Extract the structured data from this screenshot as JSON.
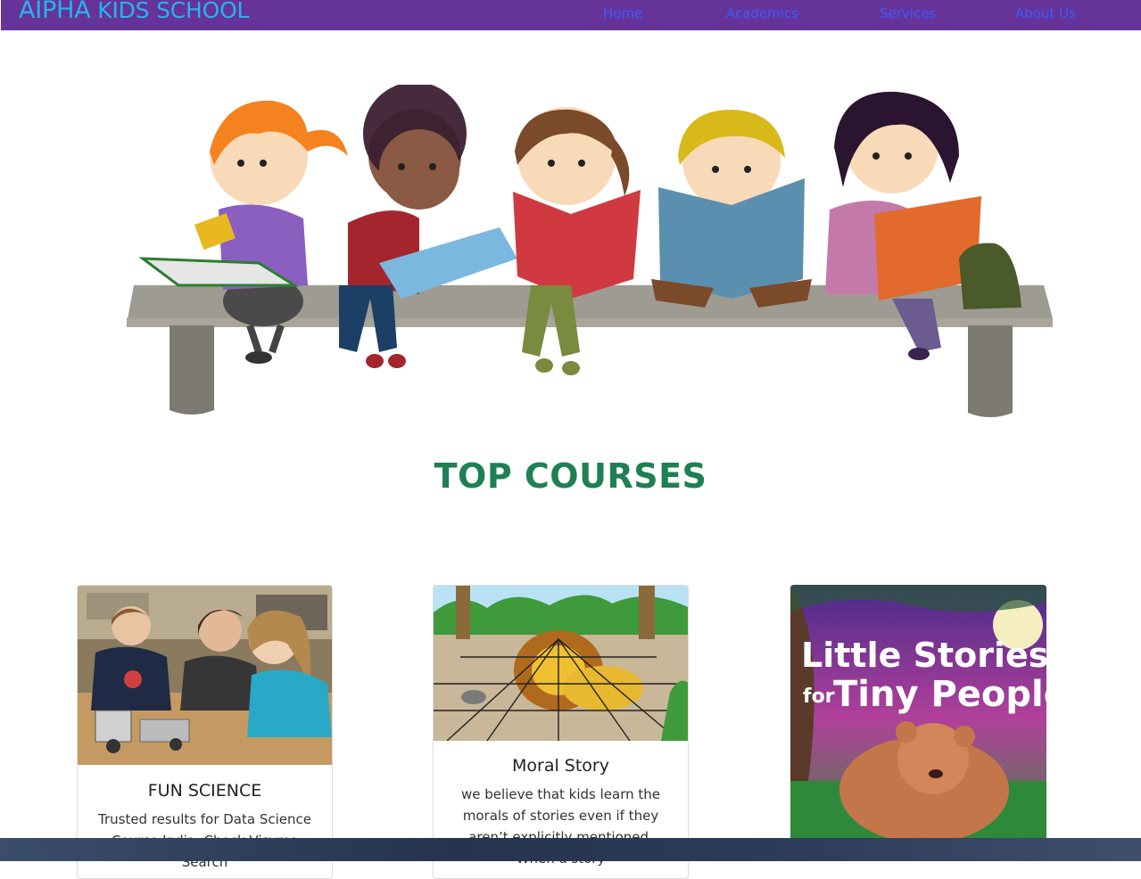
{
  "navbar": {
    "brand_big": "AIPHA",
    "brand_rest": " KIDS SCHOOL",
    "links": [
      "Home",
      "Academics",
      "Services",
      "About Us"
    ],
    "bg_color": "#663399",
    "brand_color": "#27b3f0",
    "link_color": "#3c5bff"
  },
  "section": {
    "title": "TOP COURSES",
    "title_color": "#1f7f55"
  },
  "cards": [
    {
      "title": "FUN SCIENCE",
      "text": "Trusted results for Data Science Course India. Check Visymo Search",
      "image": "kids-robotics-photo"
    },
    {
      "title": "Moral Story",
      "text": "we believe that kids learn the morals of stories even if they aren’t explicitly mentioned. When a story",
      "image": "lion-and-mouse-illustration"
    },
    {
      "image_line1": "Little Stories",
      "image_for": "for",
      "image_line2": "Tiny People",
      "image": "sleeping-bear-book-cover"
    }
  ]
}
